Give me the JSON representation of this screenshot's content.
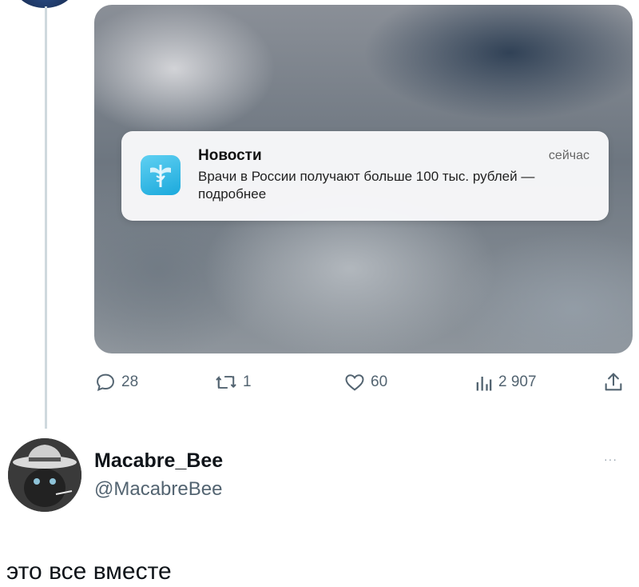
{
  "notification": {
    "app_name": "Новости",
    "time": "сейчас",
    "body": "Врачи в России получают больше 100 тыс. рублей — подробнее"
  },
  "actions": {
    "replies": "28",
    "reposts": "1",
    "likes": "60",
    "views": "2 907"
  },
  "reply": {
    "author_name": "Macabre_Bee",
    "author_handle": "@MacabreBee",
    "more": "···",
    "text": "это все вместе"
  }
}
